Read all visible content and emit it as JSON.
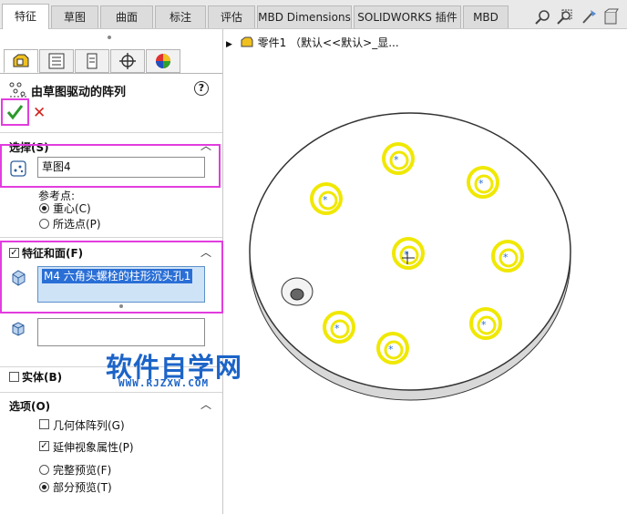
{
  "tabs": [
    "特征",
    "草图",
    "曲面",
    "标注",
    "评估",
    "MBD Dimensions",
    "SOLIDWORKS 插件",
    "MBD"
  ],
  "panel": {
    "title": "由草图驱动的阵列",
    "help": "?",
    "selection": {
      "header": "选择(S)",
      "sketch_value": "草图4",
      "reference_label": "参考点:",
      "ref_options": [
        "重心(C)",
        "所选点(P)"
      ],
      "ref_selected": 0
    },
    "features": {
      "header": "特征和面(F)",
      "checked": true,
      "item": "M4 六角头螺栓的柱形沉头孔1",
      "faces_value": ""
    },
    "bodies": {
      "header": "实体(B)",
      "checked": false
    },
    "options": {
      "header": "选项(O)",
      "items": [
        {
          "label": "几何体阵列(G)",
          "checked": false
        },
        {
          "label": "延伸视象属性(P)",
          "checked": true
        }
      ],
      "preview": [
        {
          "label": "完整预览(F)",
          "selected": false
        },
        {
          "label": "部分预览(T)",
          "selected": true
        }
      ]
    }
  },
  "tree": {
    "label": "零件1 （默认<<默认>_显..."
  },
  "watermark": {
    "main": "软件自学网",
    "sub": "WWW.RJZXW.COM"
  },
  "colors": {
    "highlight": "#e23ddf",
    "hole": "#f0e800",
    "accent": "#1c64c8"
  }
}
